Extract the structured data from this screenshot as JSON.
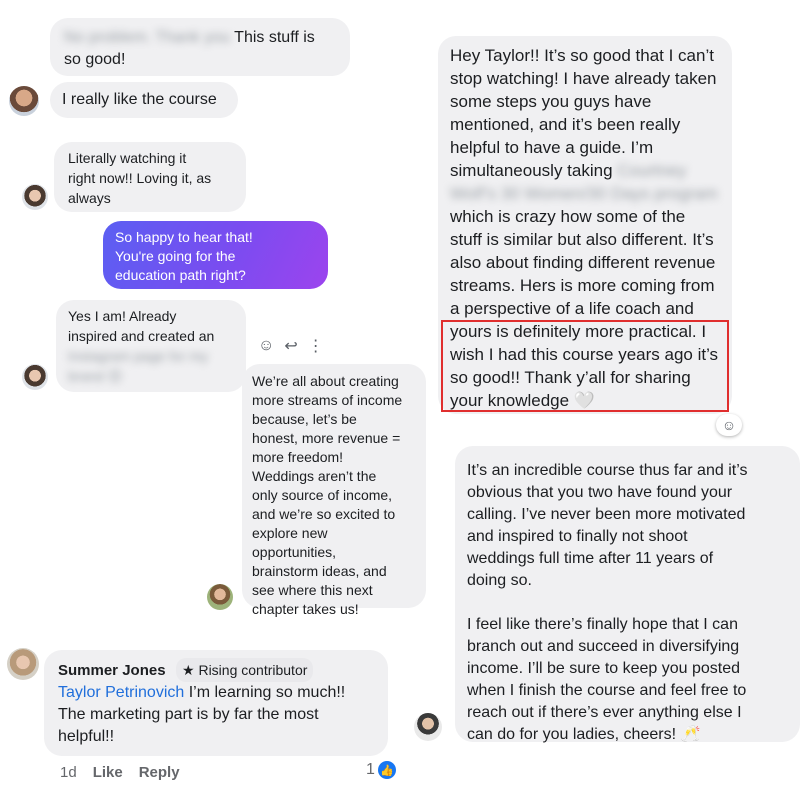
{
  "messages": {
    "m1": {
      "blurred": "No problem. Thank you",
      "text1": "This stuff is",
      "text2": "so good!"
    },
    "m2": {
      "text": "I really like the course"
    },
    "m3": {
      "lines": [
        "Literally watching it",
        "right now!! Loving it, as",
        "always"
      ]
    },
    "m4": {
      "lines": [
        "So happy to hear that!",
        "You're going for the",
        "education path right?"
      ]
    },
    "m5": {
      "lines": [
        "Yes I am! Already",
        "inspired and created an"
      ],
      "blurred": [
        "Instagram page for my",
        "brand 😊"
      ]
    },
    "m6": {
      "lines": [
        "We’re all about creating",
        "more streams of income",
        "because, let’s be",
        "honest, more revenue =",
        "more freedom!",
        "Weddings aren’t the",
        "only source of income,",
        "and we’re so excited to",
        "explore new",
        "opportunities,",
        "brainstorm ideas, and",
        "see where this next",
        "chapter takes us!"
      ]
    },
    "m7": {
      "author": "Summer Jones",
      "badge": "Rising contributor",
      "mention": "Taylor Petrinovich",
      "text": " I’m learning so much!! The marketing part is by far the most helpful!!"
    },
    "m8": {
      "lines_top": [
        "Hey Taylor!! It’s so good that I can’t",
        "stop watching! I have already taken",
        "some steps you guys have",
        "mentioned, and it’s been really",
        "helpful to have a guide. I’m",
        "simultaneously taking"
      ],
      "blurred": [
        "Courtney",
        "Wolf’s 30 Women/30 Days program"
      ],
      "lines_mid": [
        "which is crazy how some of the",
        "stuff is similar but also different. It’s",
        "also about finding different revenue",
        "streams. Hers is more coming from",
        "a perspective of a life coach and"
      ],
      "lines_highlight": [
        "yours is definitely more practical. I",
        "wish I had this course years ago it’s",
        "so good!! Thank y’all for sharing",
        "your knowledge 🤍"
      ]
    },
    "m9": {
      "para1": [
        "It’s an incredible course thus far and it’s",
        "obvious that you two have found your",
        "calling. I’ve never been more motivated",
        "and inspired to finally not shoot",
        "weddings full time after 11 years of",
        "doing so."
      ],
      "para2": [
        "I feel like there’s finally hope that I can",
        "branch out and succeed in diversifying",
        "income. I’ll be sure to keep you posted",
        "when I finish the course and feel free to",
        "reach out if there’s ever anything else I",
        "can do for you ladies, cheers! 🥂"
      ]
    }
  },
  "footer": {
    "time": "1d",
    "like": "Like",
    "reply": "Reply",
    "like_count": "1"
  },
  "icons": {
    "emoji": "☺",
    "reply": "↩",
    "more": "⋮",
    "react": "☺",
    "star": "★",
    "thumb": "👍"
  }
}
